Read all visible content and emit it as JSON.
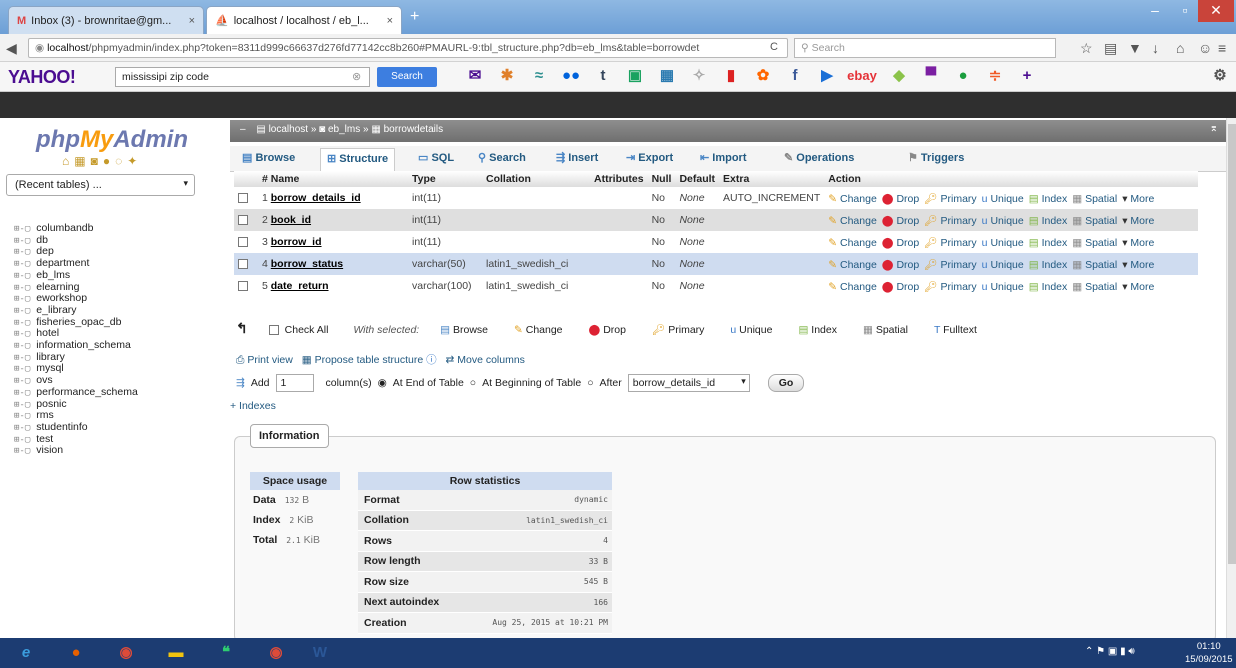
{
  "browser": {
    "tabs": [
      {
        "label": "Inbox (3) - brownritae@gm..."
      },
      {
        "label": "localhost / localhost / eb_l..."
      }
    ],
    "url_prefix": "localhost",
    "url_rest": "/phpmyadmin/index.php?token=8311d999c66637d276fd77142cc8b260#PMAURL-9:tbl_structure.php?db=eb_lms&table=borrowdet",
    "search_placeholder": "Search"
  },
  "yahoo": {
    "logo": "YAHOO!",
    "query": "mississipi zip code",
    "search_label": "Search",
    "ebay": "ebay"
  },
  "sidebar": {
    "logo_php": "php",
    "logo_my": "My",
    "logo_admin": "Admin",
    "recent": "(Recent tables) ...",
    "databases": [
      "columbandb",
      "db",
      "dep",
      "department",
      "eb_lms",
      "elearning",
      "eworkshop",
      "e_library",
      "fisheries_opac_db",
      "hotel",
      "information_schema",
      "library",
      "mysql",
      "ovs",
      "performance_schema",
      "posnic",
      "rms",
      "studentinfo",
      "test",
      "vision"
    ]
  },
  "breadcrumb": {
    "server": "localhost",
    "db": "eb_lms",
    "table": "borrowdetails"
  },
  "tabs": [
    "Browse",
    "Structure",
    "SQL",
    "Search",
    "Insert",
    "Export",
    "Import",
    "Operations",
    "Triggers"
  ],
  "structure": {
    "headers": [
      "#",
      "Name",
      "Type",
      "Collation",
      "Attributes",
      "Null",
      "Default",
      "Extra",
      "Action"
    ],
    "rows": [
      {
        "n": "1",
        "name": "borrow_details_id",
        "type": "int(11)",
        "coll": "",
        "nul": "No",
        "def": "None",
        "extra": "AUTO_INCREMENT"
      },
      {
        "n": "2",
        "name": "book_id",
        "type": "int(11)",
        "coll": "",
        "nul": "No",
        "def": "None",
        "extra": ""
      },
      {
        "n": "3",
        "name": "borrow_id",
        "type": "int(11)",
        "coll": "",
        "nul": "No",
        "def": "None",
        "extra": ""
      },
      {
        "n": "4",
        "name": "borrow_status",
        "type": "varchar(50)",
        "coll": "latin1_swedish_ci",
        "nul": "No",
        "def": "None",
        "extra": ""
      },
      {
        "n": "5",
        "name": "date_return",
        "type": "varchar(100)",
        "coll": "latin1_swedish_ci",
        "nul": "No",
        "def": "None",
        "extra": ""
      }
    ],
    "actions": [
      "Change",
      "Drop",
      "Primary",
      "Unique",
      "Index",
      "Spatial",
      "More"
    ]
  },
  "bulk": {
    "check_all": "Check All",
    "with_selected": "With selected:",
    "ops": [
      "Browse",
      "Change",
      "Drop",
      "Primary",
      "Unique",
      "Index",
      "Spatial",
      "Fulltext"
    ]
  },
  "links": {
    "print": "Print view",
    "propose": "Propose table structure",
    "move": "Move columns"
  },
  "addcol": {
    "label": "Add",
    "count": "1",
    "text": "column(s)",
    "opt1": "At End of Table",
    "opt2": "At Beginning of Table",
    "opt3": "After",
    "after_value": "borrow_details_id",
    "go": "Go"
  },
  "indexes_link": "+ Indexes",
  "information": {
    "legend": "Information",
    "space_header": "Space usage",
    "space": [
      {
        "k": "Data",
        "v": "132",
        "u": "B"
      },
      {
        "k": "Index",
        "v": "2",
        "u": "KiB"
      },
      {
        "k": "Total",
        "v": "2.1",
        "u": "KiB"
      }
    ],
    "row_header": "Row statistics",
    "rows": [
      {
        "k": "Format",
        "v": "dynamic"
      },
      {
        "k": "Collation",
        "v": "latin1_swedish_ci"
      },
      {
        "k": "Rows",
        "v": "4"
      },
      {
        "k": "Row length",
        "v": "33 B"
      },
      {
        "k": "Row size",
        "v": "545 B"
      },
      {
        "k": "Next autoindex",
        "v": "166"
      },
      {
        "k": "Creation",
        "v": "Aug 25, 2015 at 10:21 PM"
      }
    ]
  },
  "taskbar": {
    "time": "01:10",
    "date": "15/09/2015"
  }
}
